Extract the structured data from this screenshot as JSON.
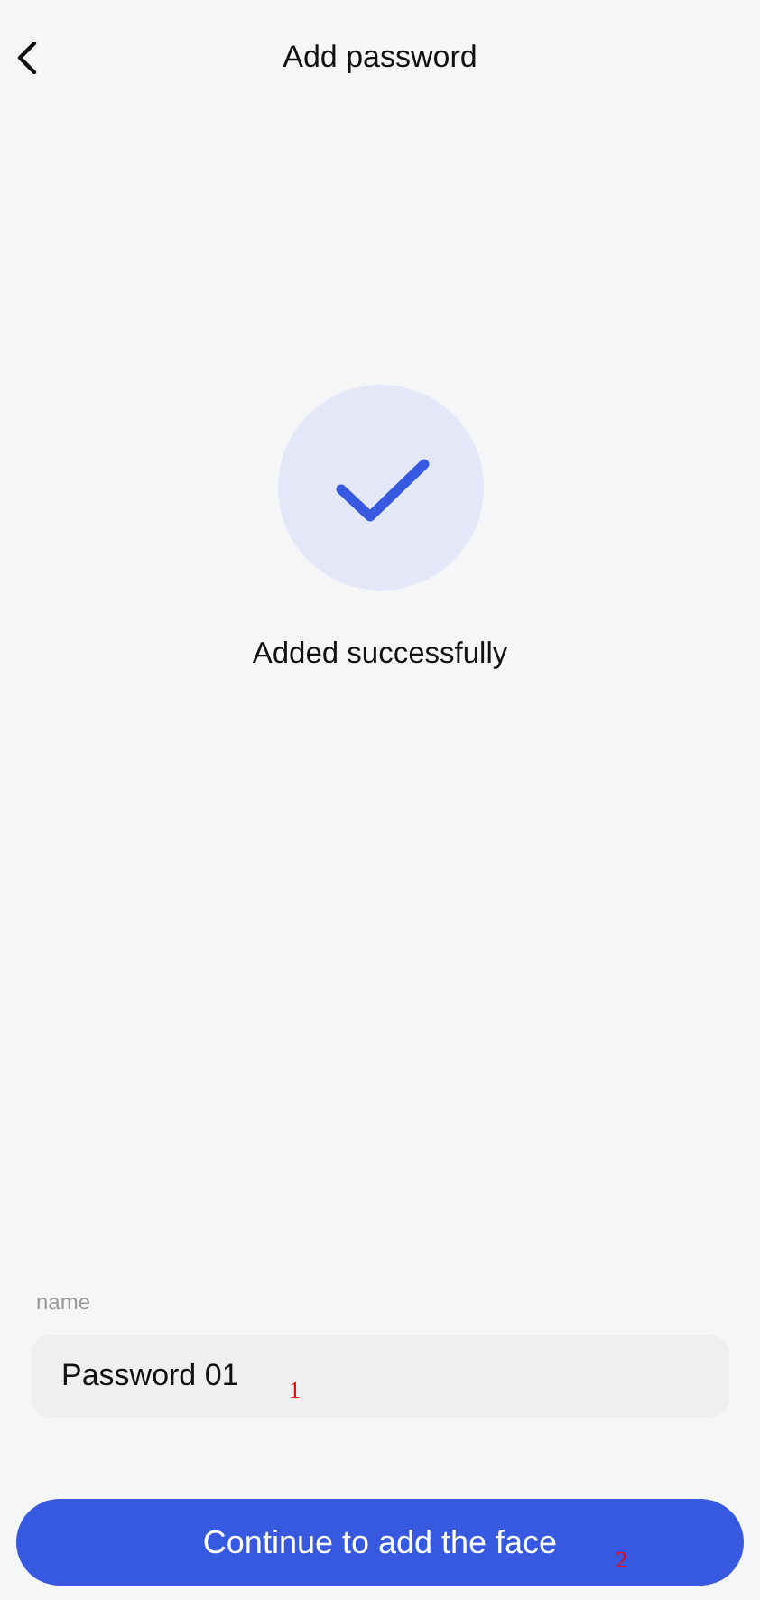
{
  "header": {
    "title": "Add password"
  },
  "status": {
    "message": "Added successfully"
  },
  "name_field": {
    "label": "name",
    "value": "Password 01"
  },
  "primary_button": {
    "label": "Continue to add the face"
  },
  "markers": [
    "1",
    "2"
  ]
}
